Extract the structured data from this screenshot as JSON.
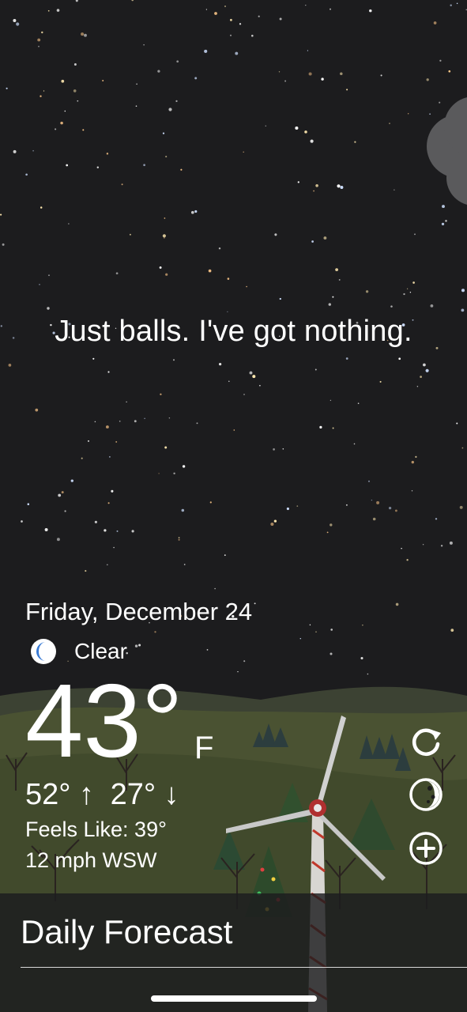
{
  "quip": "Just balls. I've got nothing.",
  "date": "Friday, December 24",
  "condition": {
    "label": "Clear",
    "icon": "moon-icon"
  },
  "temperature": {
    "value": "43°",
    "unit": "F"
  },
  "high_low": {
    "high": "52° ↑",
    "low": "27° ↓"
  },
  "feels_like": "Feels Like: 39°",
  "wind": "12 mph WSW",
  "actions": [
    "refresh-icon",
    "moon-phase-icon",
    "add-location-icon"
  ],
  "daily_forecast": {
    "title": "Daily Forecast"
  },
  "colors": {
    "sky": "#1c1c1e",
    "hill": "#43492f",
    "moon_icon": "#3a7bd5",
    "text": "#ffffff"
  }
}
